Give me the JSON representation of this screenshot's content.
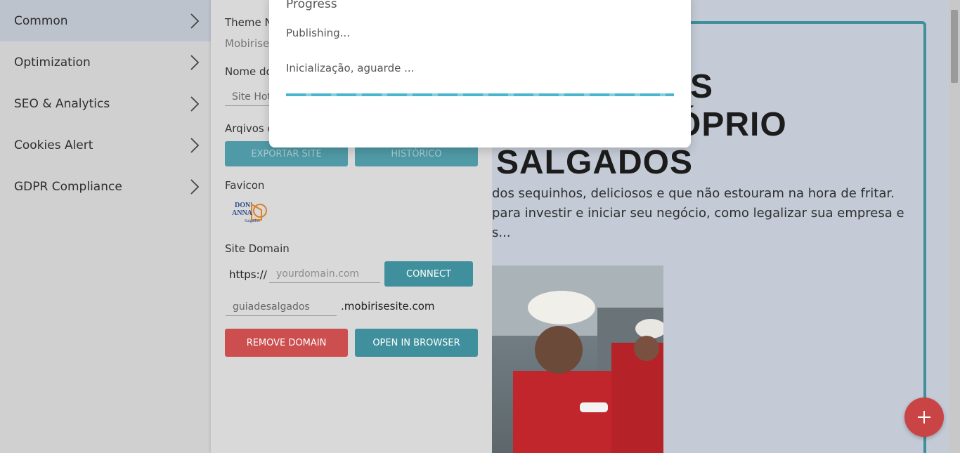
{
  "menu": {
    "items": [
      {
        "label": "Common",
        "active": true
      },
      {
        "label": "Optimization",
        "active": false
      },
      {
        "label": "SEO & Analytics",
        "active": false
      },
      {
        "label": "Cookies Alert",
        "active": false
      },
      {
        "label": "GDPR Compliance",
        "active": false
      }
    ]
  },
  "panel": {
    "theme_label": "Theme N",
    "theme_value": "Mobirise",
    "site_name_label": "Nome do",
    "site_name_value": "Site Hot",
    "files_label": "Arqivos d",
    "export_button": "EXPORTAR SITE",
    "history_button": "HISTÓRICO",
    "favicon_label": "Favicon",
    "favicon_logo": {
      "line1": "DON'",
      "line2": "ANNA",
      "line3": "Salgados"
    },
    "site_domain_label": "Site Domain",
    "https_prefix": "https://",
    "domain_placeholder": "yourdomain.com",
    "connect_button": "CONNECT",
    "subdomain_value": "guiadesalgados",
    "subdomain_suffix": ".mobirisesite.com",
    "remove_domain_button": "REMOVE DOMAIN",
    "open_browser_button": "OPEN IN BROWSER"
  },
  "preview": {
    "heading_line1": "S",
    "heading_line2": "ÓPRIO",
    "heading_line3": "SALGADOS",
    "para_line1": "dos sequinhos, deliciosos e que não estouram na hora de fritar.",
    "para_line2": "para investir e iniciar seu negócio, como legalizar sua empresa e",
    "para_line3": "s..."
  },
  "modal": {
    "title": "Progress",
    "status": "Publishing...",
    "message": "Inicialização, aguarde ...",
    "progress_percent": 100
  },
  "colors": {
    "accent_teal": "#3f8f9c",
    "danger_red": "#cc4e4e",
    "progress_blue": "#48b6cc",
    "fab_red": "#c94444"
  }
}
